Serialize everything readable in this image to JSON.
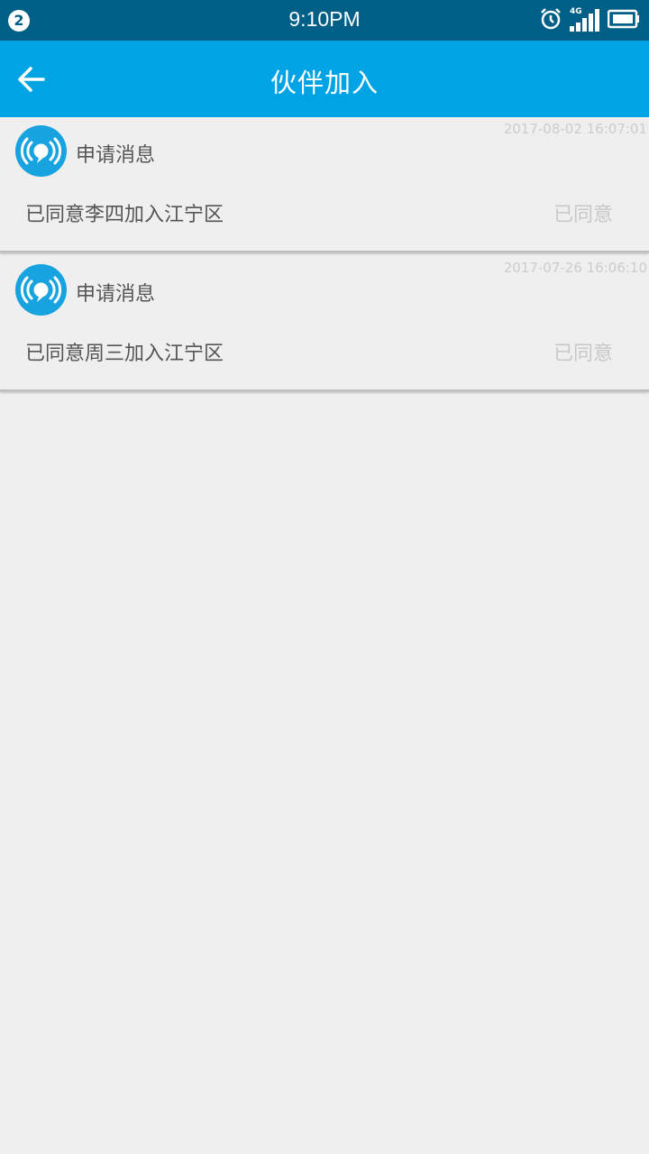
{
  "status_bar": {
    "notification_count": "2",
    "time": "9:10PM",
    "network": "4G",
    "icons": [
      "alarm-icon",
      "signal-icon",
      "battery-icon"
    ]
  },
  "app_bar": {
    "title": "伙伴加入",
    "back_icon": "arrow-left-icon"
  },
  "messages": [
    {
      "timestamp": "2017-08-02 16:07:01",
      "type_label": "申请消息",
      "content": "已同意李四加入江宁区",
      "status": "已同意"
    },
    {
      "timestamp": "2017-07-26 16:06:10",
      "type_label": "申请消息",
      "content": "已同意周三加入江宁区",
      "status": "已同意"
    }
  ],
  "colors": {
    "status_bar": "#005f86",
    "app_bar": "#00a4e4",
    "accent": "#17a2e0",
    "background": "#efefef"
  }
}
